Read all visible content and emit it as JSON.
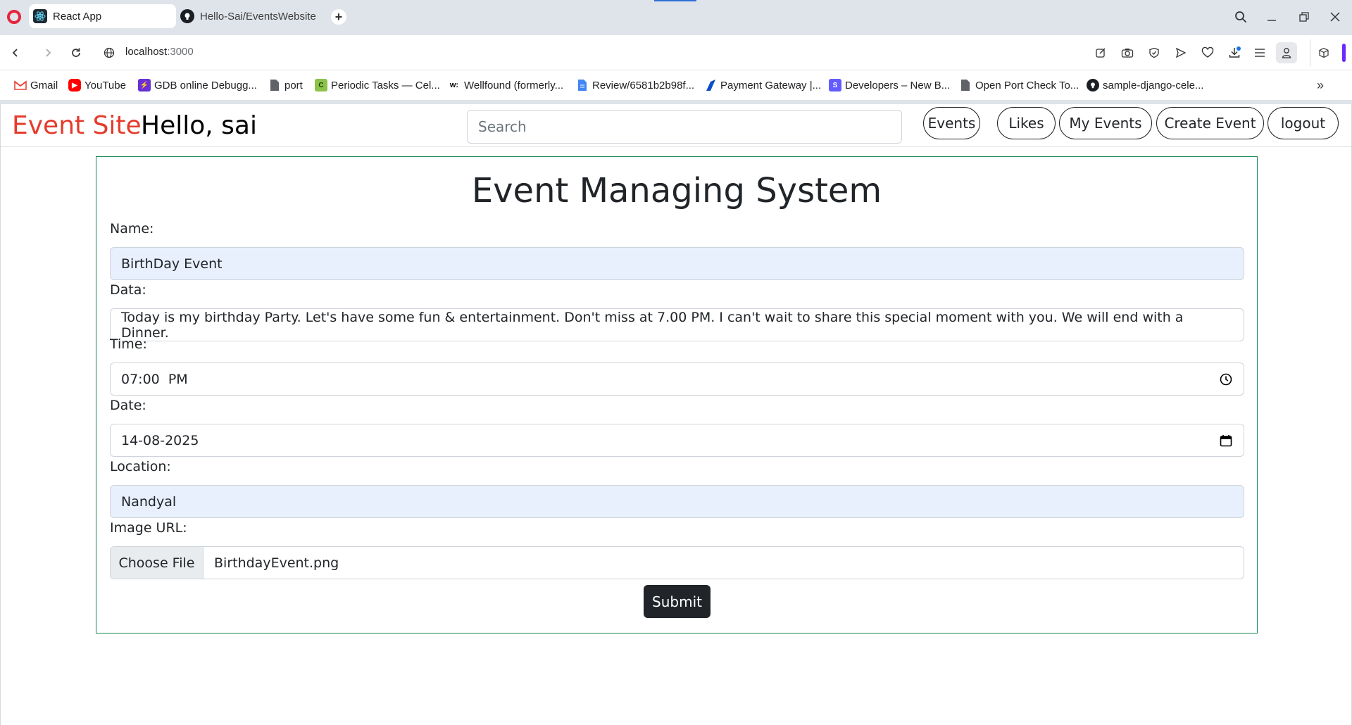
{
  "browser": {
    "tabs": [
      {
        "title": "React App",
        "icon": "react-icon"
      },
      {
        "title": "Hello-Sai/EventsWebsite",
        "icon": "github-icon"
      }
    ],
    "url_host": "localhost",
    "url_port": ":3000",
    "bookmarks": [
      {
        "label": "Gmail",
        "icon": "gmail-icon"
      },
      {
        "label": "YouTube",
        "icon": "youtube-icon"
      },
      {
        "label": "GDB online Debugg...",
        "icon": "gdb-icon"
      },
      {
        "label": "port",
        "icon": "page-icon"
      },
      {
        "label": "Periodic Tasks — Cel...",
        "icon": "celery-icon"
      },
      {
        "label": "Wellfound (formerly...",
        "icon": "wellfound-icon"
      },
      {
        "label": "Review/6581b2b98f...",
        "icon": "docs-icon"
      },
      {
        "label": "Payment Gateway |...",
        "icon": "razorpay-icon"
      },
      {
        "label": "Developers – New B...",
        "icon": "stripe-icon"
      },
      {
        "label": "Open Port Check To...",
        "icon": "page-icon"
      },
      {
        "label": "sample-django-cele...",
        "icon": "github-icon"
      }
    ]
  },
  "app": {
    "brand": "Event Site",
    "greeting": "Hello, sai",
    "search_placeholder": "Search",
    "nav": [
      "Events",
      "Likes",
      "My Events",
      "Create Event",
      "logout"
    ]
  },
  "form": {
    "title": "Event Managing System",
    "name_label": "Name:",
    "name_value": "BirthDay Event",
    "data_label": "Data:",
    "data_value": "Today is my birthday Party. Let's have some fun & entertainment. Don't miss at 7.00 PM. I can't wait to share this special moment with you. We will end with a Dinner.",
    "time_label": "Time:",
    "time_value": "07:00  PM",
    "date_label": "Date:",
    "date_value": "14-08-2025",
    "location_label": "Location:",
    "location_value": "Nandyal",
    "image_label": "Image URL:",
    "file_button": "Choose File",
    "file_name": "BirthdayEvent.png",
    "submit_label": "Submit"
  },
  "colors": {
    "brand": "#e53b2c",
    "card_border": "#198754",
    "autofill_bg": "#e8f0fe",
    "submit_bg": "#212529"
  }
}
